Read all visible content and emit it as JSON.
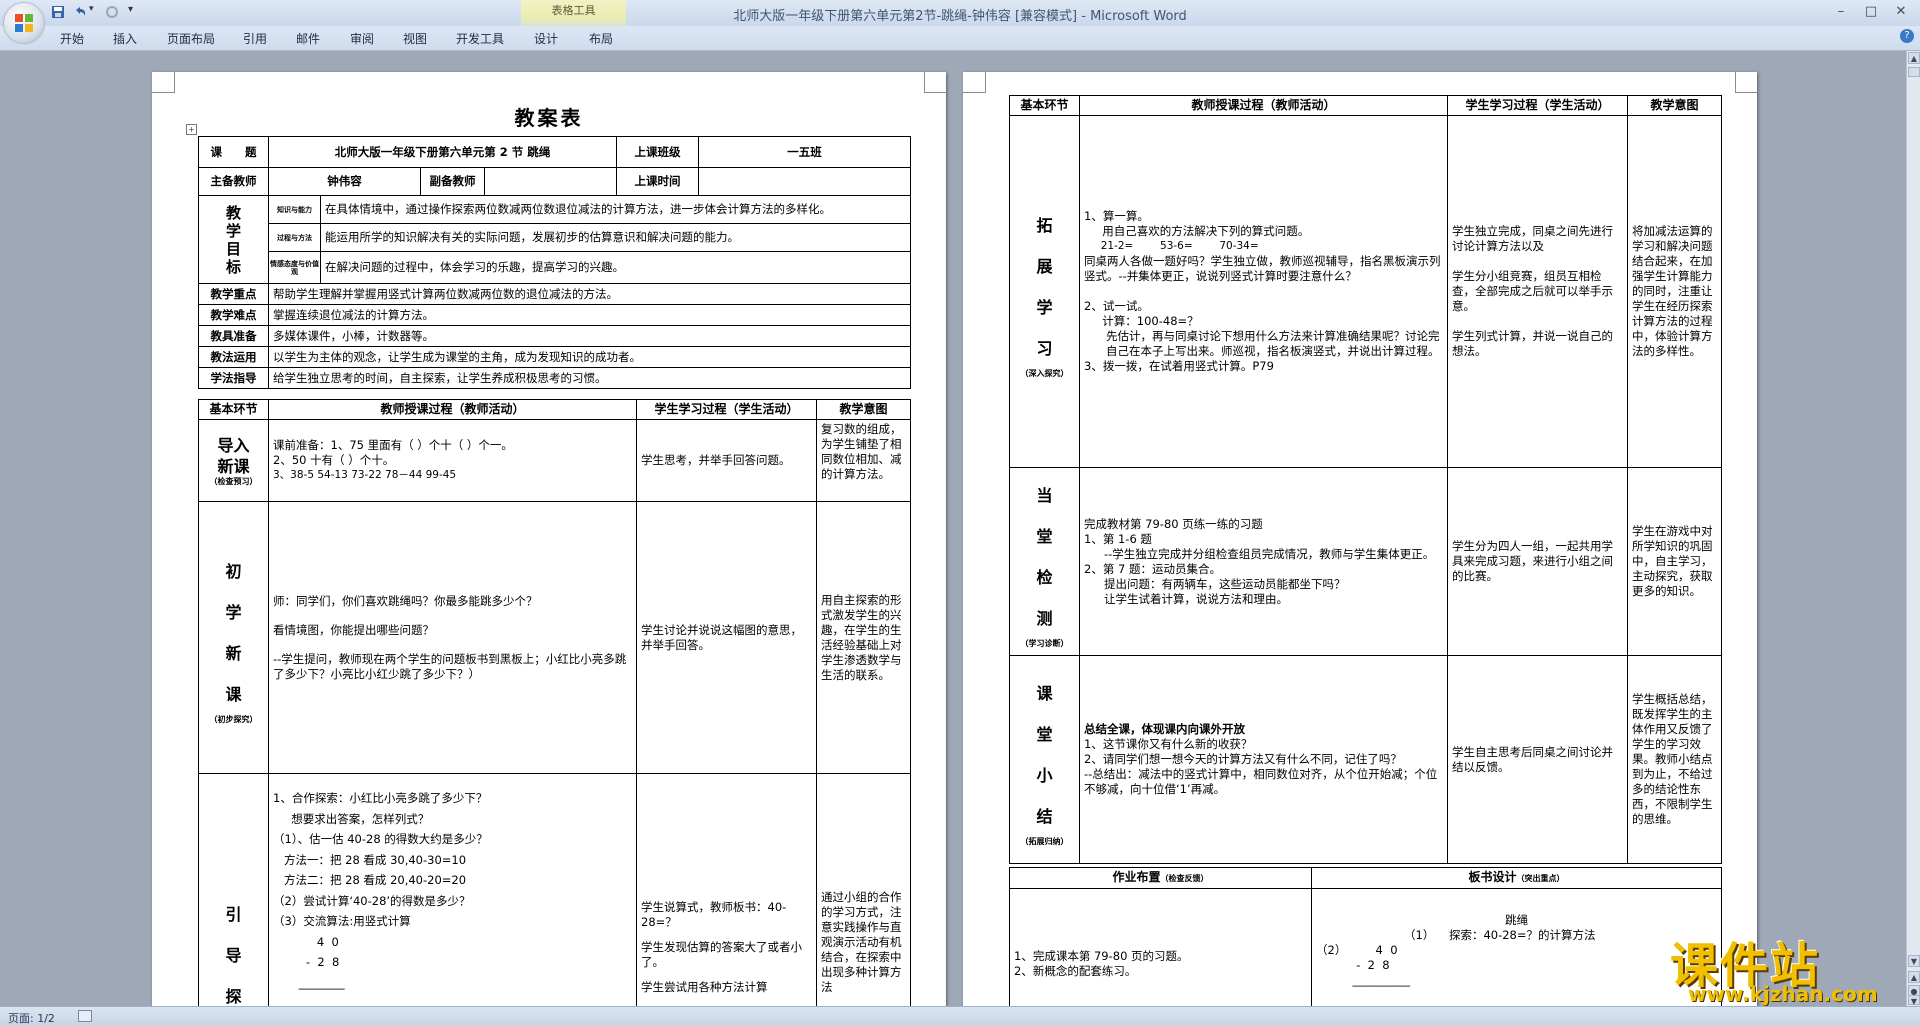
{
  "app": {
    "title": "北师大版一年级下册第六单元第2节-跳绳-钟伟容 [兼容模式] - Microsoft Word",
    "table_tools_label": "表格工具",
    "tabs": [
      "开始",
      "插入",
      "页面布局",
      "引用",
      "邮件",
      "审阅",
      "视图",
      "开发工具",
      "设计",
      "布局"
    ],
    "help_glyph": "?",
    "window_controls": [
      "–",
      "□",
      "✕"
    ]
  },
  "status": {
    "page": "页面: 1/2"
  },
  "watermark": {
    "main": "课件站",
    "url": "www.kjzhan.com"
  },
  "page1": {
    "doc_title": "教案表",
    "info": {
      "topic_label": "课　　题",
      "topic": "北师大版一年级下册第六单元第 2 节  跳绳",
      "class_label": "上课班级",
      "class": "一五班",
      "teacher_label": "主备教师",
      "teacher": "钟伟容",
      "assistant_label": "副备教师",
      "assistant": "",
      "time_label": "上课时间",
      "time": ""
    },
    "goals": {
      "label": [
        "教",
        "学",
        "目",
        "标"
      ],
      "rows": [
        {
          "tag": "知识与能力",
          "text": "在具体情境中，通过操作探索两位数减两位数退位减法的计算方法，进一步体会计算方法的多样化。"
        },
        {
          "tag": "过程与方法",
          "text": "能运用所学的知识解决有关的实际问题，发展初步的估算意识和解决问题的能力。"
        },
        {
          "tag": "情感态度与价值观",
          "text": "在解决问题的过程中，体会学习的乐趣，提高学习的兴趣。"
        }
      ]
    },
    "rows": [
      {
        "label": "教学重点",
        "text": "帮助学生理解并掌握用竖式计算两位数减两位数的退位减法的方法。"
      },
      {
        "label": "教学难点",
        "text": "掌握连续退位减法的计算方法。"
      },
      {
        "label": "教具准备",
        "text": "多媒体课件，小棒，计数器等。"
      },
      {
        "label": "教法运用",
        "text": "以学生为主体的观念，让学生成为课堂的主角，成为发现知识的成功者。"
      },
      {
        "label": "学法指导",
        "text": "给学生独立思考的时间，自主探索，让学生养成积极思考的习惯。"
      }
    ],
    "headers": {
      "stage": "基本环节",
      "teacher": "教师授课过程（教师活动）",
      "student": "学生学习过程（学生活动）",
      "intent": "教学意图"
    },
    "stages": [
      {
        "name": [
          "导入",
          "新课"
        ],
        "sub": "（检查预习）",
        "teacher": [
          "课前准备：1、75 里面有（  ）个十（  ）个一。",
          "2、50 十有（  ）个十。",
          "3、38-5    54-13     73-22    78－44    99-45"
        ],
        "student": [
          "学生思考，并举手回答问题。"
        ],
        "intent": [
          "复习数的组成，为学生铺垫了相同数位相加、减的计算方法。"
        ]
      },
      {
        "name": [
          "初",
          "学",
          "新",
          "课"
        ],
        "sub": "（初步探究）",
        "teacher": [
          "师：同学们，你们喜欢跳绳吗？你最多能跳多少个？",
          "看情境图，你能提出哪些问题？",
          "--学生提问，教师现在两个学生的问题板书到黑板上；小红比小亮多跳了多少下？小亮比小红少跳了多少下？）"
        ],
        "student": [
          "学生讨论并说说这幅图的意思，并举手回答。"
        ],
        "intent": [
          "用自主探索的形式激发学生的兴趣，在学生的生活经验基础上对学生渗透数学与生活的联系。"
        ]
      },
      {
        "name": [
          "引",
          "导",
          "探"
        ],
        "sub": "",
        "teacher": [
          "1、合作探索：小红比小亮多跳了多少下？",
          "     想要求出答案，怎样列式？",
          "（1）、估一估 40-28 的得数大约是多少？",
          "   方法一：把 28 看成 30,40-30=10",
          "   方法二：把 28 看成 20,40-20=20",
          "（2）尝试计算‘40-28’的得数是多少？",
          "（3）交流算法:用竖式计算",
          "            4  0",
          "         -  2  8",
          "       ________"
        ],
        "student": [
          "学生说算式，教师板书：40-28=？",
          "学生发现估算的答案大了或者小了。",
          "学生尝试用各种方法计算"
        ],
        "intent": [
          "通过小组的合作的学习方式，注意实践操作与直观演示活动有机结合，在探索中出现多种计算方法"
        ]
      }
    ]
  },
  "page2": {
    "headers": {
      "stage": "基本环节",
      "teacher": "教师授课过程（教师活动）",
      "student": "学生学习过程（学生活动）",
      "intent": "教学意图"
    },
    "stages": [
      {
        "name": [
          "拓",
          "展",
          "学",
          "习"
        ],
        "sub": "（深入探究）",
        "teacher": [
          "1、算一算。",
          "     用自己喜欢的方法解决下列的算式问题。",
          "     21-2=        53-6=        70-34=",
          "同桌两人各做一题好吗？学生独立做，教师巡视辅导，指名黑板演示列竖式。--并集体更正，说说列竖式计算时要注意什么？",
          "",
          "2、试一试。",
          "     计算：100-48=？",
          "     先估计，再与同桌讨论下想用什么方法来计算准确结果呢？讨论完自己在本子上写出来。师巡视，指名板演竖式，并说出计算过程。",
          "3、拨一拨，在试着用竖式计算。P79"
        ],
        "student": [
          "学生独立完成，同桌之间先进行讨论计算方法以及",
          "",
          "学生分小组竞赛，组员互相检查，全部完成之后就可以举手示意。",
          "",
          "学生列式计算，并说一说自己的想法。"
        ],
        "intent": [
          "将加减法运算的学习和解决问题结合起来，在加强学生计算能力的同时，注重让学生在经历探索计算方法的过程中，体验计算方法的多样性。"
        ]
      },
      {
        "name": [
          "当",
          "堂",
          "检",
          "测"
        ],
        "sub": "（学习诊断）",
        "teacher": [
          "完成教材第 79-80 页练一练的习题",
          "1、第 1-6 题",
          "     --学生独立完成并分组检查组员完成情况，教师与学生集体更正。",
          "2、第 7 题：运动员集合。",
          "     提出问题：有两辆车，这些运动员能都坐下吗？",
          "     让学生试着计算，说说方法和理由。"
        ],
        "student": [
          "学生分为四人一组，一起共用学具来完成习题，来进行小组之间的比赛。"
        ],
        "intent": [
          "学生在游戏中对所学知识的巩固中，自主学习，主动探究，获取更多的知识。"
        ]
      },
      {
        "name": [
          "课",
          "堂",
          "小",
          "结"
        ],
        "sub": "（拓展归纳）",
        "teacher": [
          "总结全课，体现课内向课外开放",
          "1、这节课你又有什么新的收获？",
          "2、请同学们想一想今天的计算方法又有什么不同，记住了吗？",
          "--总结出：减法中的竖式计算中，相同数位对齐，从个位开始减；个位不够减，向十位借‘1’再减。"
        ],
        "student": [
          "学生自主思考后同桌之间讨论并结以反馈。"
        ],
        "intent": [
          "学生概括总结，既发挥学生的主体作用又反馈了学生的学习效果。教师小结点到为止，不给过多的结论性东西，不限制学生的思维。"
        ]
      }
    ],
    "homework": {
      "label": "作业布置",
      "sub": "（检查反馈）",
      "items": [
        "1、完成课本第 79-80 页的习题。",
        "2、新概念的配套练习。"
      ]
    },
    "board": {
      "label": "板书设计",
      "sub": "（突出重点）",
      "title": "跳绳",
      "lines": [
        "（1）    探索：40-28=？的计算方法",
        "（2）        4  0",
        "           -  2  8",
        "          __________"
      ]
    }
  }
}
